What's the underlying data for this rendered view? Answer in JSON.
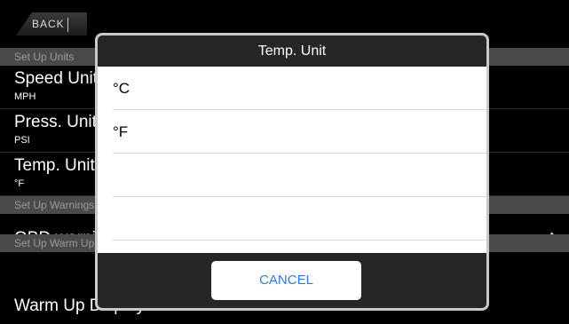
{
  "nav": {
    "back_label": "BACK"
  },
  "sections": {
    "setup_units": "Set Up Units",
    "setup_warnings": "Set Up Warnings",
    "setup_warmup": "Set Up Warm Up"
  },
  "rows": {
    "speed": {
      "label": "Speed Unit",
      "value": "MPH"
    },
    "press": {
      "label": "Press. Unit",
      "value": "PSI"
    },
    "temp": {
      "label": "Temp. Unit",
      "value": "°F"
    },
    "obd": {
      "label": "OBD warning"
    },
    "warmup": {
      "label": "Warm Up Display"
    }
  },
  "dialog": {
    "title": "Temp. Unit",
    "options": [
      "°C",
      "°F",
      "",
      ""
    ],
    "cancel_label": "CANCEL"
  },
  "colors": {
    "accent": "#2f7dea",
    "header_bg": "#262626",
    "section_bg": "#4a4a4a"
  },
  "icons": {
    "disclosure": "chevron-right-icon"
  }
}
